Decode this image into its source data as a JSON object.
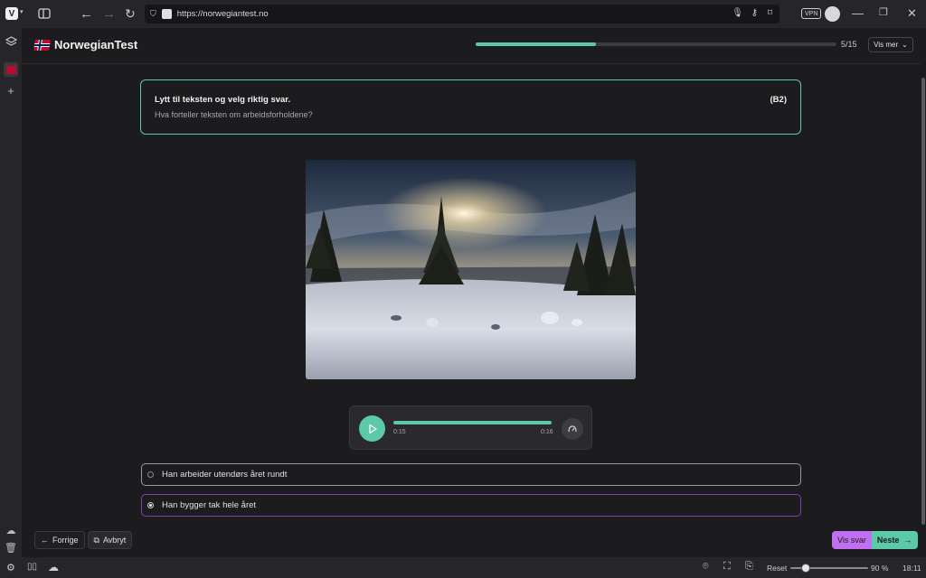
{
  "browser": {
    "url": "https://norwegiantest.no",
    "vpn_label": "VPN"
  },
  "app": {
    "brand": "NorwegianTest",
    "progress_label": "5/15",
    "progress_fraction": 0.3333,
    "vis_mer_label": "Vis mer"
  },
  "question": {
    "title": "Lytt til teksten og velg riktig svar.",
    "subtitle": "Hva forteller teksten om arbeidsforholdene?",
    "level": "(B2)"
  },
  "audio": {
    "current": "0:15",
    "duration": "0:16",
    "progress_fraction": 1.0
  },
  "options": [
    {
      "label": "Han arbeider utendørs året rundt",
      "selected": false
    },
    {
      "label": "Han bygger tak hele året",
      "selected": true
    }
  ],
  "footer": {
    "prev_label": "Forrige",
    "cancel_label": "Avbryt",
    "show_answer_label": "Vis svar",
    "next_label": "Neste"
  },
  "statusbar": {
    "reset_label": "Reset",
    "zoom_label": "90 %",
    "zoom_fraction": 0.2,
    "time": "18:11"
  },
  "colors": {
    "accent": "#5cc9a7",
    "selected_border": "#7b3fbf",
    "vis_svar": "#c06ff0"
  }
}
